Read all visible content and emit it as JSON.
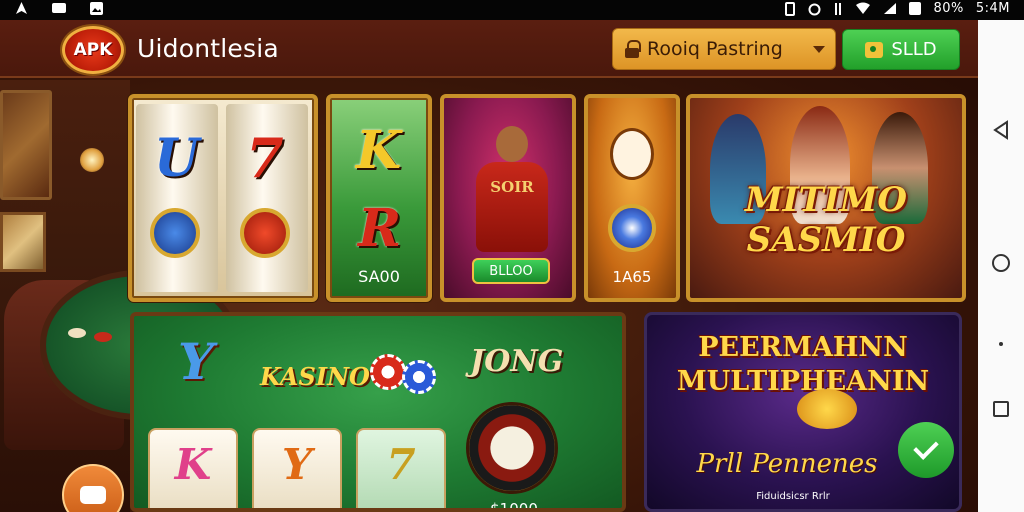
{
  "status_bar": {
    "right_text": "80%",
    "time": "5:4M"
  },
  "header": {
    "logo_text": "APK",
    "title": "Uidontlesia",
    "language_select": {
      "value": "Rooiq Pastring",
      "icon": "lock-icon"
    },
    "slot_button": {
      "label": "SLLD",
      "icon": "ticket-icon"
    }
  },
  "games": {
    "reels": {
      "symbols": [
        "U",
        "7"
      ]
    },
    "k_card": {
      "letters": [
        "K",
        "R"
      ],
      "price": "SA00"
    },
    "hero_card": {
      "label": "SOIR",
      "button": "BLLOO"
    },
    "clown_card": {
      "price": "1A65"
    },
    "feature": {
      "title_line1": "MITIMO",
      "title_line2": "SASMIO"
    }
  },
  "table": {
    "logo_y": "Y",
    "logo_kasino": "KASINO",
    "logo_jong": "JONG",
    "cards": [
      {
        "letter": "K",
        "color": "#e0408a"
      },
      {
        "letter": "Y",
        "color": "#e06a14"
      },
      {
        "letter": "7",
        "color": "#c8a020"
      }
    ],
    "roulette_price": "$1000"
  },
  "promo": {
    "title_line1": "PEERMAHNN",
    "title_line2": "MULTIPHEANIN",
    "subtitle": "Prll Pennenes",
    "small": "Fiduidsicsr Rrlr"
  },
  "nav": {
    "back": "back-icon",
    "home": "home-icon",
    "recent": "recent-apps-icon"
  },
  "colors": {
    "accent_green": "#22a02a",
    "accent_gold": "#dd9426",
    "header_bg": "#5a1e10"
  }
}
